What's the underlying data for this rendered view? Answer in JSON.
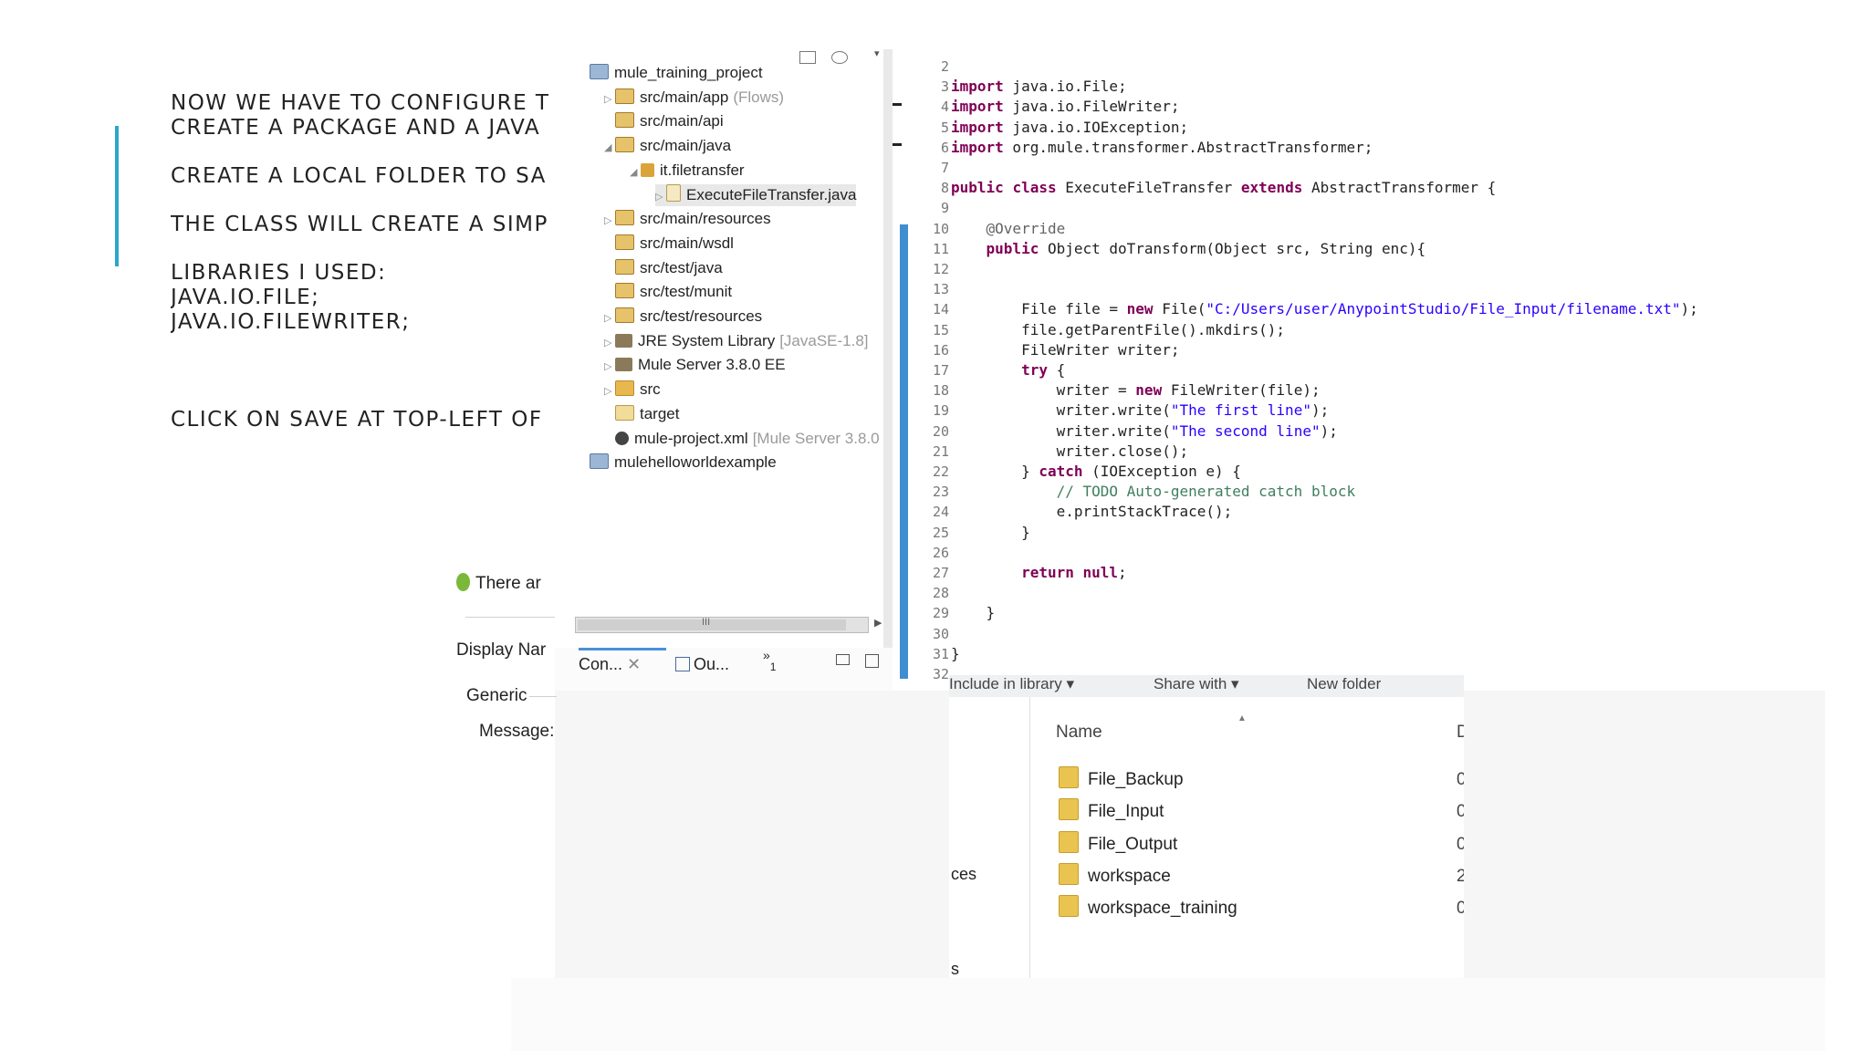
{
  "slide": {
    "paragraphs": [
      [
        "NOW WE HAVE TO CONFIGURE T",
        "CREATE A PACKAGE AND A JAVA"
      ],
      [
        "CREATE A LOCAL FOLDER TO SA"
      ],
      [
        "THE CLASS WILL CREATE A SIMP"
      ],
      [
        "LIBRARIES I USED:",
        "JAVA.IO.FILE;",
        "JAVA.IO.FILEWRITER;"
      ],
      [
        "CLICK ON SAVE AT TOP-LEFT OF"
      ]
    ],
    "accent_color": "#2aa7c9"
  },
  "dialog": {
    "status": "There ar",
    "display_name_label": "Display Nar",
    "section": "Generic",
    "message_label": "Message:"
  },
  "explorer": {
    "items": [
      {
        "label": "mule_training_project",
        "icon": "project-icon",
        "suffix": ""
      },
      {
        "label": "src/main/app",
        "icon": "source-folder-icon",
        "suffix": "(Flows)"
      },
      {
        "label": "src/main/api",
        "icon": "source-folder-icon",
        "suffix": ""
      },
      {
        "label": "src/main/java",
        "icon": "source-folder-icon",
        "suffix": ""
      },
      {
        "label": "it.filetransfer",
        "icon": "package-icon",
        "suffix": ""
      },
      {
        "label": "ExecuteFileTransfer.java",
        "icon": "java-file-icon",
        "suffix": ""
      },
      {
        "label": "src/main/resources",
        "icon": "source-folder-icon",
        "suffix": ""
      },
      {
        "label": "src/main/wsdl",
        "icon": "source-folder-icon",
        "suffix": ""
      },
      {
        "label": "src/test/java",
        "icon": "source-folder-icon",
        "suffix": ""
      },
      {
        "label": "src/test/munit",
        "icon": "source-folder-icon",
        "suffix": ""
      },
      {
        "label": "src/test/resources",
        "icon": "source-folder-icon",
        "suffix": ""
      },
      {
        "label": "JRE System Library",
        "icon": "library-icon",
        "suffix": "[JavaSE-1.8]"
      },
      {
        "label": "Mule Server 3.8.0 EE",
        "icon": "library-icon",
        "suffix": ""
      },
      {
        "label": "src",
        "icon": "folder-icon",
        "suffix": ""
      },
      {
        "label": "target",
        "icon": "folder-icon",
        "suffix": ""
      },
      {
        "label": "mule-project.xml",
        "icon": "gear-icon",
        "suffix": "[Mule Server 3.8.0"
      },
      {
        "label": "mulehelloworldexample",
        "icon": "project-icon",
        "suffix": ""
      }
    ],
    "scroll_grip": "III",
    "tabs": {
      "console": "Con...",
      "outline": "Ou...",
      "overflow": "»",
      "overflow_count": "1"
    }
  },
  "editor": {
    "lines": [
      {
        "n": "2",
        "t": ""
      },
      {
        "n": "3",
        "t": "import java.io.File;"
      },
      {
        "n": "4",
        "t": "import java.io.FileWriter;"
      },
      {
        "n": "5",
        "t": "import java.io.IOException;"
      },
      {
        "n": "6",
        "t": "import org.mule.transformer.AbstractTransformer;"
      },
      {
        "n": "7",
        "t": ""
      },
      {
        "n": "8",
        "t": "public class ExecuteFileTransfer extends AbstractTransformer {"
      },
      {
        "n": "9",
        "t": ""
      },
      {
        "n": "10",
        "t": "    @Override"
      },
      {
        "n": "11",
        "t": "    public Object doTransform(Object src, String enc){"
      },
      {
        "n": "12",
        "t": ""
      },
      {
        "n": "13",
        "t": ""
      },
      {
        "n": "14",
        "t": "        File file = new File(\"C:/Users/user/AnypointStudio/File_Input/filename.txt\");"
      },
      {
        "n": "15",
        "t": "        file.getParentFile().mkdirs();"
      },
      {
        "n": "16",
        "t": "        FileWriter writer;"
      },
      {
        "n": "17",
        "t": "        try {"
      },
      {
        "n": "18",
        "t": "            writer = new FileWriter(file);"
      },
      {
        "n": "19",
        "t": "            writer.write(\"The first line\");"
      },
      {
        "n": "20",
        "t": "            writer.write(\"The second line\");"
      },
      {
        "n": "21",
        "t": "            writer.close();"
      },
      {
        "n": "22",
        "t": "        } catch (IOException e) {"
      },
      {
        "n": "23",
        "t": "            // TODO Auto-generated catch block"
      },
      {
        "n": "24",
        "t": "            e.printStackTrace();"
      },
      {
        "n": "25",
        "t": "        }"
      },
      {
        "n": "26",
        "t": ""
      },
      {
        "n": "27",
        "t": "        return null;"
      },
      {
        "n": "28",
        "t": ""
      },
      {
        "n": "29",
        "t": "    }"
      },
      {
        "n": "30",
        "t": ""
      },
      {
        "n": "31",
        "t": "}"
      },
      {
        "n": "32",
        "t": ""
      }
    ]
  },
  "file_explorer": {
    "toolbar": [
      "Include in library ▾",
      "Share with ▾",
      "New folder"
    ],
    "column_name": "Name",
    "column_date": "D",
    "nav": [
      "ces",
      "s"
    ],
    "folders": [
      {
        "name": "File_Backup",
        "date": "0"
      },
      {
        "name": "File_Input",
        "date": "0"
      },
      {
        "name": "File_Output",
        "date": "0"
      },
      {
        "name": "workspace",
        "date": "2"
      },
      {
        "name": "workspace_training",
        "date": "0"
      }
    ]
  }
}
